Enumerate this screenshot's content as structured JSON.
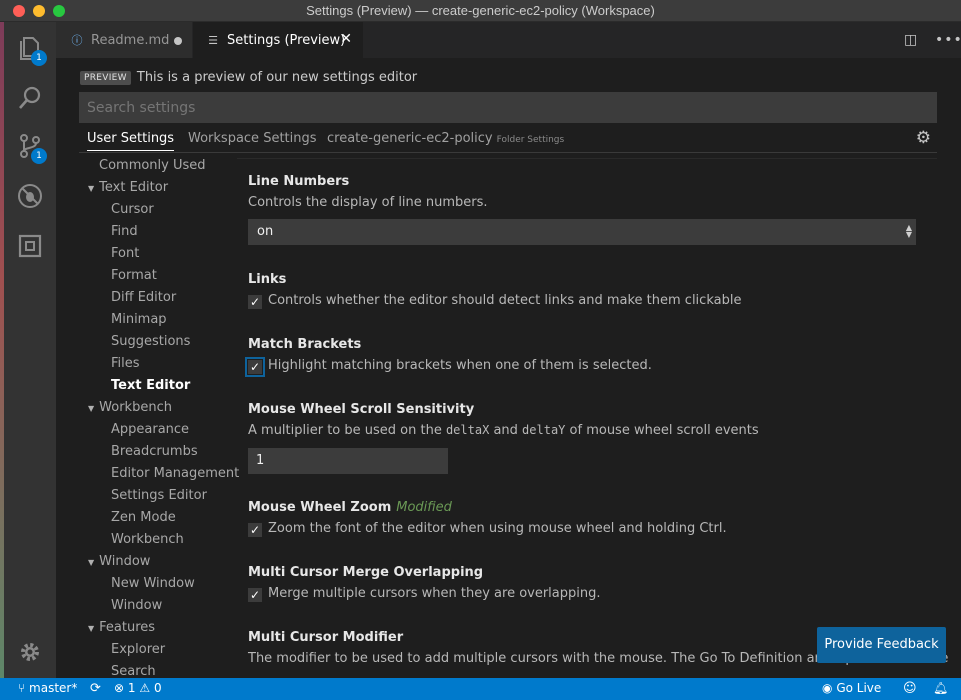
{
  "window": {
    "title": "Settings (Preview) — create-generic-ec2-policy (Workspace)"
  },
  "activity_bar": {
    "items": [
      {
        "name": "explorer",
        "badge": "1"
      },
      {
        "name": "search"
      },
      {
        "name": "source-control",
        "badge": "1"
      },
      {
        "name": "debug"
      },
      {
        "name": "extensions"
      }
    ]
  },
  "tabs": [
    {
      "label": "Readme.md",
      "icon": "info-icon",
      "dirty": true
    },
    {
      "label": "Settings (Preview)",
      "icon": "list-icon",
      "active": true
    }
  ],
  "settings": {
    "preview_tag": "PREVIEW",
    "preview_text": "This is a preview of our new settings editor",
    "search_placeholder": "Search settings",
    "scopes": {
      "user": "User Settings",
      "workspace": "Workspace Settings",
      "folder": "create-generic-ec2-policy",
      "folder_hint": "Folder Settings"
    },
    "toc": [
      {
        "label": "Commonly Used",
        "level": 0
      },
      {
        "label": "Text Editor",
        "level": 0,
        "expanded": true
      },
      {
        "label": "Cursor",
        "level": 1
      },
      {
        "label": "Find",
        "level": 1
      },
      {
        "label": "Font",
        "level": 1
      },
      {
        "label": "Format",
        "level": 1
      },
      {
        "label": "Diff Editor",
        "level": 1
      },
      {
        "label": "Minimap",
        "level": 1
      },
      {
        "label": "Suggestions",
        "level": 1
      },
      {
        "label": "Files",
        "level": 1
      },
      {
        "label": "Text Editor",
        "level": 1,
        "selected": true
      },
      {
        "label": "Workbench",
        "level": 0,
        "expanded": true
      },
      {
        "label": "Appearance",
        "level": 1
      },
      {
        "label": "Breadcrumbs",
        "level": 1
      },
      {
        "label": "Editor Management",
        "level": 1
      },
      {
        "label": "Settings Editor",
        "level": 1
      },
      {
        "label": "Zen Mode",
        "level": 1
      },
      {
        "label": "Workbench",
        "level": 1
      },
      {
        "label": "Window",
        "level": 0,
        "expanded": true
      },
      {
        "label": "New Window",
        "level": 1
      },
      {
        "label": "Window",
        "level": 1
      },
      {
        "label": "Features",
        "level": 0,
        "expanded": true
      },
      {
        "label": "Explorer",
        "level": 1
      },
      {
        "label": "Search",
        "level": 1
      }
    ],
    "items": {
      "line_numbers": {
        "title": "Line Numbers",
        "desc": "Controls the display of line numbers.",
        "value": "on"
      },
      "links": {
        "title": "Links",
        "desc": "Controls whether the editor should detect links and make them clickable",
        "checked": true
      },
      "match_brackets": {
        "title": "Match Brackets",
        "desc": "Highlight matching brackets when one of them is selected.",
        "checked": true
      },
      "scroll_sensitivity": {
        "title": "Mouse Wheel Scroll Sensitivity",
        "desc_a": "A multiplier to be used on the ",
        "code_a": "deltaX",
        "desc_b": " and ",
        "code_b": "deltaY",
        "desc_c": " of mouse wheel scroll events",
        "value": "1"
      },
      "wheel_zoom": {
        "title": "Mouse Wheel Zoom",
        "modified": "Modified",
        "desc": "Zoom the font of the editor when using mouse wheel and holding Ctrl.",
        "checked": true
      },
      "cursor_merge": {
        "title": "Multi Cursor Merge Overlapping",
        "desc": "Merge multiple cursors when they are overlapping.",
        "checked": true
      },
      "cursor_modifier": {
        "title": "Multi Cursor Modifier",
        "desc": "The modifier to be used to add multiple cursors with the mouse. The Go To Definition and Open Link mouse"
      }
    },
    "feedback_label": "Provide Feedback"
  },
  "status_bar": {
    "branch": "master*",
    "errors": "1",
    "warnings": "0",
    "go_live": "Go Live"
  },
  "colors": {
    "accent": "#007acc",
    "status_bar": "#007acc",
    "modified": "#6a9955"
  }
}
